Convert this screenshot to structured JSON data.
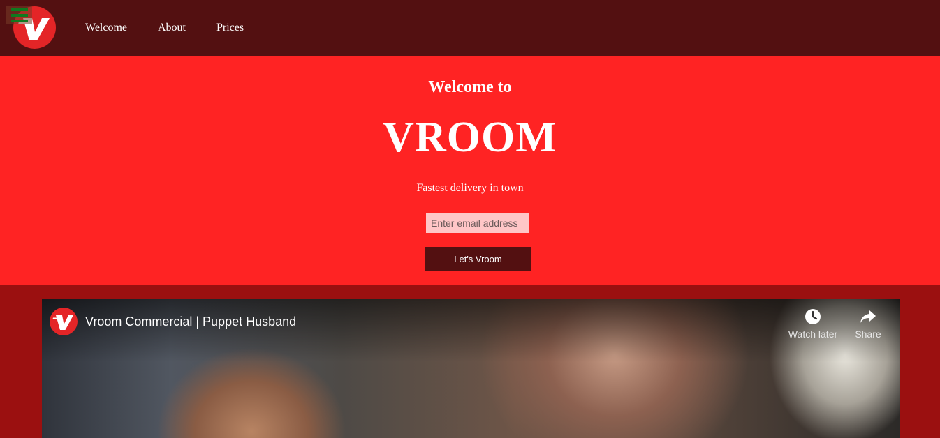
{
  "nav": {
    "logo_alt": "Vroom logo",
    "links": [
      "Welcome",
      "About",
      "Prices"
    ]
  },
  "hero": {
    "kicker": "Welcome to",
    "title": "VROOM",
    "tagline": "Fastest delivery in town",
    "email_placeholder": "Enter email address",
    "email_value": "",
    "cta_label": "Let's Vroom"
  },
  "video": {
    "title": "Vroom Commercial | Puppet Husband",
    "actions": [
      {
        "label": "Watch later",
        "icon": "clock-icon"
      },
      {
        "label": "Share",
        "icon": "share-icon"
      }
    ]
  },
  "colors": {
    "nav_bg": "#531011",
    "hero_bg": "#ff2323",
    "page_bg": "#9b1010",
    "brand_red": "#e42527",
    "input_bg": "#ffc6c7",
    "button_bg": "#531011"
  }
}
